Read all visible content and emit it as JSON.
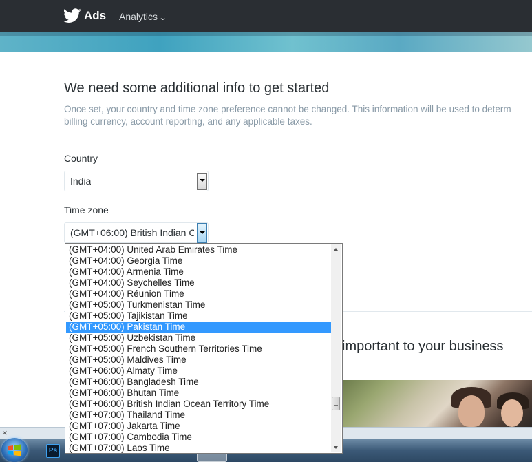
{
  "nav": {
    "brand": "Ads",
    "analytics_label": "Analytics"
  },
  "page": {
    "title": "We need some additional info to get started",
    "subtitle_line1": "Once set, your country and time zone preference cannot be changed. This information will be used to determ",
    "subtitle_line2": "billing currency, account reporting, and any applicable taxes.",
    "country_label": "Country",
    "country_value": "India",
    "timezone_label": "Time zone",
    "timezone_value": "(GMT+06:00) British Indian O",
    "hero_text": "important to your business"
  },
  "timezone_options": [
    "(GMT+04:00) United Arab Emirates Time",
    "(GMT+04:00) Georgia Time",
    "(GMT+04:00) Armenia Time",
    "(GMT+04:00) Seychelles Time",
    "(GMT+04:00) Réunion Time",
    "(GMT+05:00) Turkmenistan Time",
    "(GMT+05:00) Tajikistan Time",
    "(GMT+05:00) Pakistan Time",
    "(GMT+05:00) Uzbekistan Time",
    "(GMT+05:00) French Southern Territories Time",
    "(GMT+05:00) Maldives Time",
    "(GMT+06:00) Almaty Time",
    "(GMT+06:00) Bangladesh Time",
    "(GMT+06:00) Bhutan Time",
    "(GMT+06:00) British Indian Ocean Territory Time",
    "(GMT+07:00) Thailand Time",
    "(GMT+07:00) Jakarta Time",
    "(GMT+07:00) Cambodia Time",
    "(GMT+07:00) Laos Time"
  ],
  "highlighted_option": "(GMT+05:00) Pakistan Time",
  "taskbar": {
    "close_glyph": "×",
    "ps_label": "Ps"
  },
  "colors": {
    "nav_bg": "#2a2e33",
    "highlight": "#3399ff",
    "muted_text": "#8899a6"
  }
}
